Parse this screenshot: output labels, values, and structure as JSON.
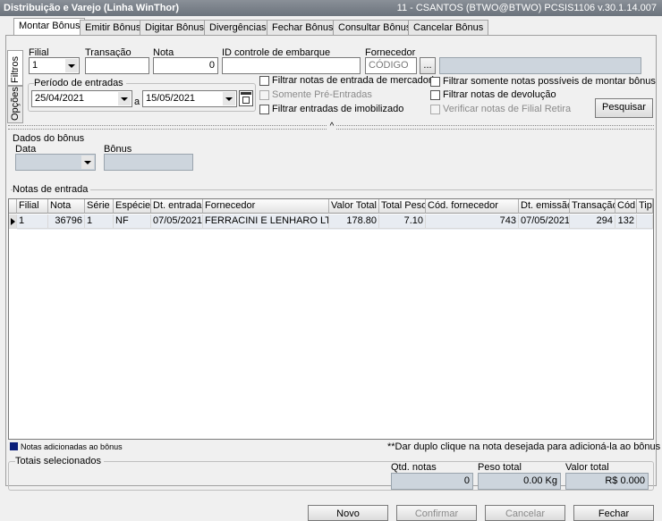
{
  "window": {
    "title": "Distribuição e Varejo (Linha WinThor)",
    "right_info": "11 - CSANTOS (BTWO@BTWO)   PCSIS1106  v.30.1.14.007"
  },
  "tabs": [
    "Montar Bônus",
    "Emitir Bônus",
    "Digitar Bônus",
    "Divergências",
    "Fechar Bônus",
    "Consultar Bônus",
    "Cancelar Bônus"
  ],
  "side_tabs": {
    "filtros": "Filtros",
    "opcoes": "Opções"
  },
  "filters": {
    "filial_label": "Filial",
    "filial_value": "1",
    "transacao_label": "Transação",
    "transacao_value": "",
    "nota_label": "Nota",
    "nota_value": "0",
    "id_controle_label": "ID controle de embarque",
    "id_controle_value": "",
    "fornecedor_label": "Fornecedor",
    "fornecedor_placeholder": "CÓDIGO",
    "fornecedor_lookup": "...",
    "periodo_label": "Período de entradas",
    "data_inicio": "25/04/2021",
    "a_label": "a",
    "data_fim": "15/05/2021",
    "chk_entrada_mercadoria": "Filtrar notas de entrada de mercadoria",
    "chk_somente_pre": "Somente Pré-Entradas",
    "chk_imobilizado": "Filtrar entradas de imobilizado",
    "chk_possiveis": "Filtrar somente notas possíveis de montar bônus",
    "chk_devolucao": "Filtrar notas de devolução",
    "chk_filial_retira": "Verificar notas de Filial Retira",
    "pesquisar": "Pesquisar"
  },
  "dados_bonus": {
    "title": "Dados do bônus",
    "data_label": "Data",
    "bonus_label": "Bônus"
  },
  "notas": {
    "title": "Notas de entrada",
    "columns": [
      "Filial",
      "Nota",
      "Série",
      "Espécie",
      "Dt. entrada",
      "Fornecedor",
      "Valor Total",
      "Total Peso",
      "Cód. fornecedor",
      "Dt. emissão",
      "Transação",
      "Cód",
      "Tipo"
    ],
    "rows": [
      [
        "1",
        "36796",
        "1",
        "NF",
        "07/05/2021",
        "FERRACINI E LENHARO LTDA",
        "178.80",
        "7.10",
        "743",
        "07/05/2021",
        "294",
        "132",
        ""
      ]
    ]
  },
  "legend": "Notas adicionadas ao bônus",
  "hint": "**Dar duplo clique na nota desejada para adicioná-la ao bônus",
  "totais": {
    "title": "Totais selecionados",
    "qtd_label": "Qtd. notas",
    "qtd_value": "0",
    "peso_label": "Peso total",
    "peso_value": "0.00 Kg",
    "valor_label": "Valor total",
    "valor_value": "R$ 0.000"
  },
  "footer": {
    "novo": "Novo",
    "confirmar": "Confirmar",
    "cancelar": "Cancelar",
    "fechar": "Fechar"
  },
  "colors": {
    "legend_swatch": "#0b1f7a",
    "gray_field": "#cdd5dd"
  }
}
